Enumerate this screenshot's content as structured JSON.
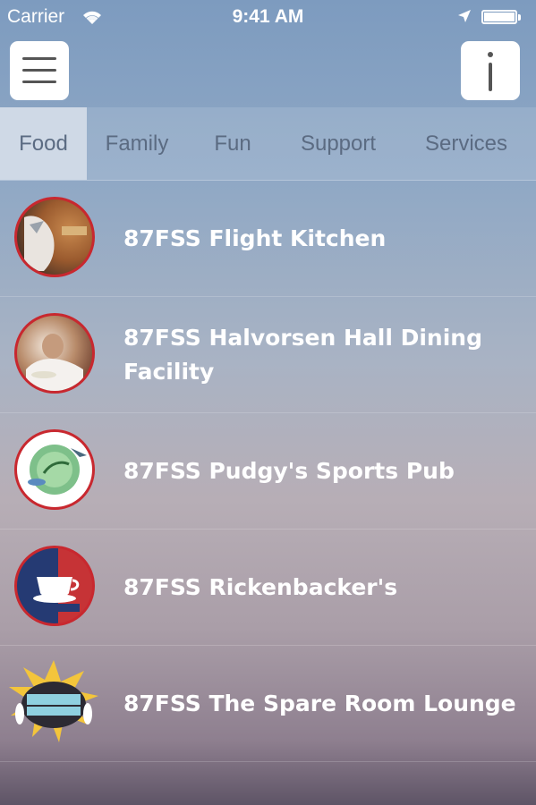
{
  "status_bar": {
    "carrier": "Carrier",
    "time": "9:41 AM"
  },
  "header": {
    "menu_icon": "hamburger-menu-icon",
    "info_icon": "info-icon"
  },
  "tabs": [
    {
      "label": "Food",
      "active": true
    },
    {
      "label": "Family",
      "active": false
    },
    {
      "label": "Fun",
      "active": false
    },
    {
      "label": "Support",
      "active": false
    },
    {
      "label": "Services",
      "active": false
    }
  ],
  "items": [
    {
      "label": "87FSS Flight Kitchen",
      "icon": "flight-kitchen-logo"
    },
    {
      "label": "87FSS Halvorsen Hall Dining Facility",
      "icon": "dining-facility-photo"
    },
    {
      "label": "87FSS Pudgy's Sports Pub",
      "icon": "sports-pub-logo"
    },
    {
      "label": "87FSS Rickenbacker's",
      "icon": "rickenbackers-logo"
    },
    {
      "label": "87FSS The Spare Room Lounge",
      "icon": "spare-room-logo"
    }
  ],
  "colors": {
    "accent_red": "#c8282f",
    "tab_active_bg": "#cfd9e6",
    "tab_text": "#5b6b82"
  }
}
